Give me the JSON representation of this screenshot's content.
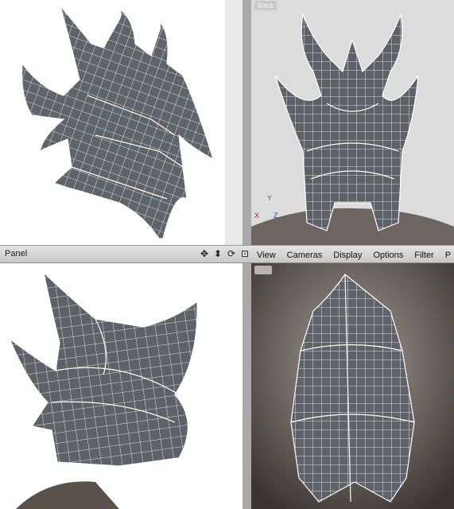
{
  "panel_bar": {
    "label": "Panel",
    "icons": [
      "move-icon",
      "dolly-icon",
      "rotate-icon",
      "maximize-icon"
    ]
  },
  "menu": [
    "View",
    "Cameras",
    "Display",
    "Options",
    "Filter",
    "P"
  ],
  "viewport_top_right": {
    "camera_label": "Back"
  },
  "axis": {
    "x": "X",
    "y": "Y",
    "z": "Z"
  }
}
